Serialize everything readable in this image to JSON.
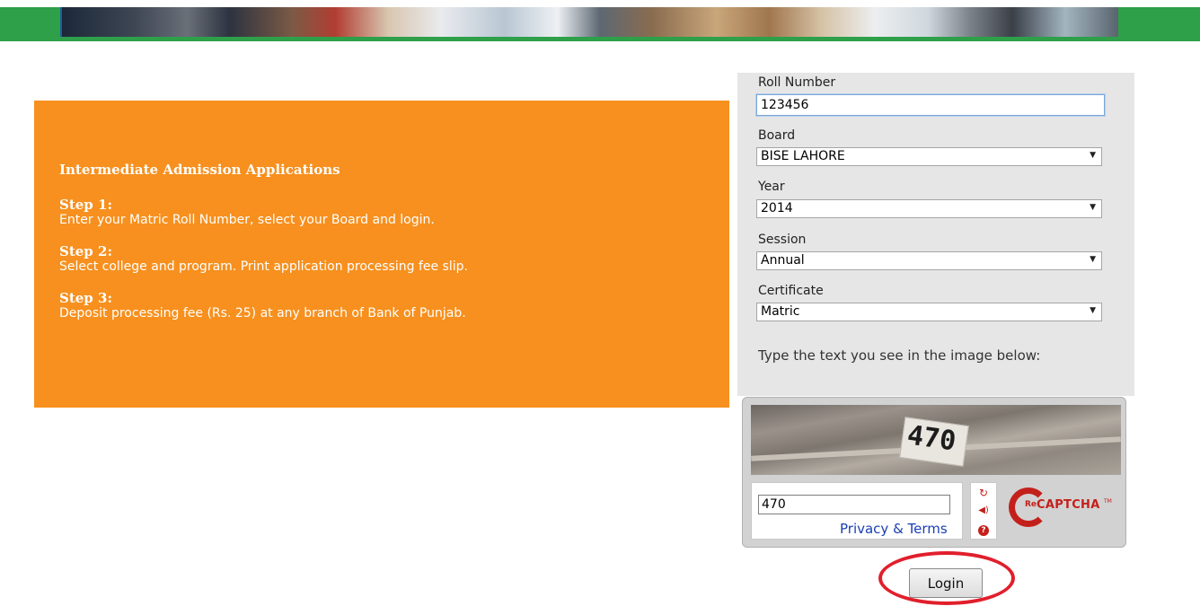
{
  "info": {
    "title": "Intermediate Admission Applications",
    "steps": [
      {
        "heading": "Step 1:",
        "text": "Enter your Matric Roll Number, select your Board and login."
      },
      {
        "heading": "Step 2:",
        "text": "Select college and program. Print application processing fee slip."
      },
      {
        "heading": "Step 3:",
        "text": "Deposit processing fee (Rs. 25) at any branch of Bank of Punjab."
      }
    ]
  },
  "form": {
    "roll_number": {
      "label": "Roll Number",
      "value": "123456"
    },
    "board": {
      "label": "Board",
      "value": "BISE LAHORE"
    },
    "year": {
      "label": "Year",
      "value": "2014"
    },
    "session": {
      "label": "Session",
      "value": "Annual"
    },
    "certificate": {
      "label": "Certificate",
      "value": "Matric"
    },
    "captcha_hint": "Type the text you see in the image below:"
  },
  "captcha": {
    "image_text": "470",
    "input_value": "470",
    "privacy_link": "Privacy & Terms",
    "logo_re": "Re",
    "logo_text": "CAPTCHA",
    "logo_tm": "TM",
    "icons": [
      "refresh-icon",
      "audio-icon",
      "help-icon"
    ],
    "help_glyph": "?"
  },
  "login_label": "Login",
  "colors": {
    "banner_green": "#2ea04a",
    "info_orange": "#f7901e",
    "panel_gray": "#e6e6e6",
    "recaptcha_red": "#c4201b",
    "highlight_red": "#e11f2c",
    "link_blue": "#1a3fb3"
  }
}
